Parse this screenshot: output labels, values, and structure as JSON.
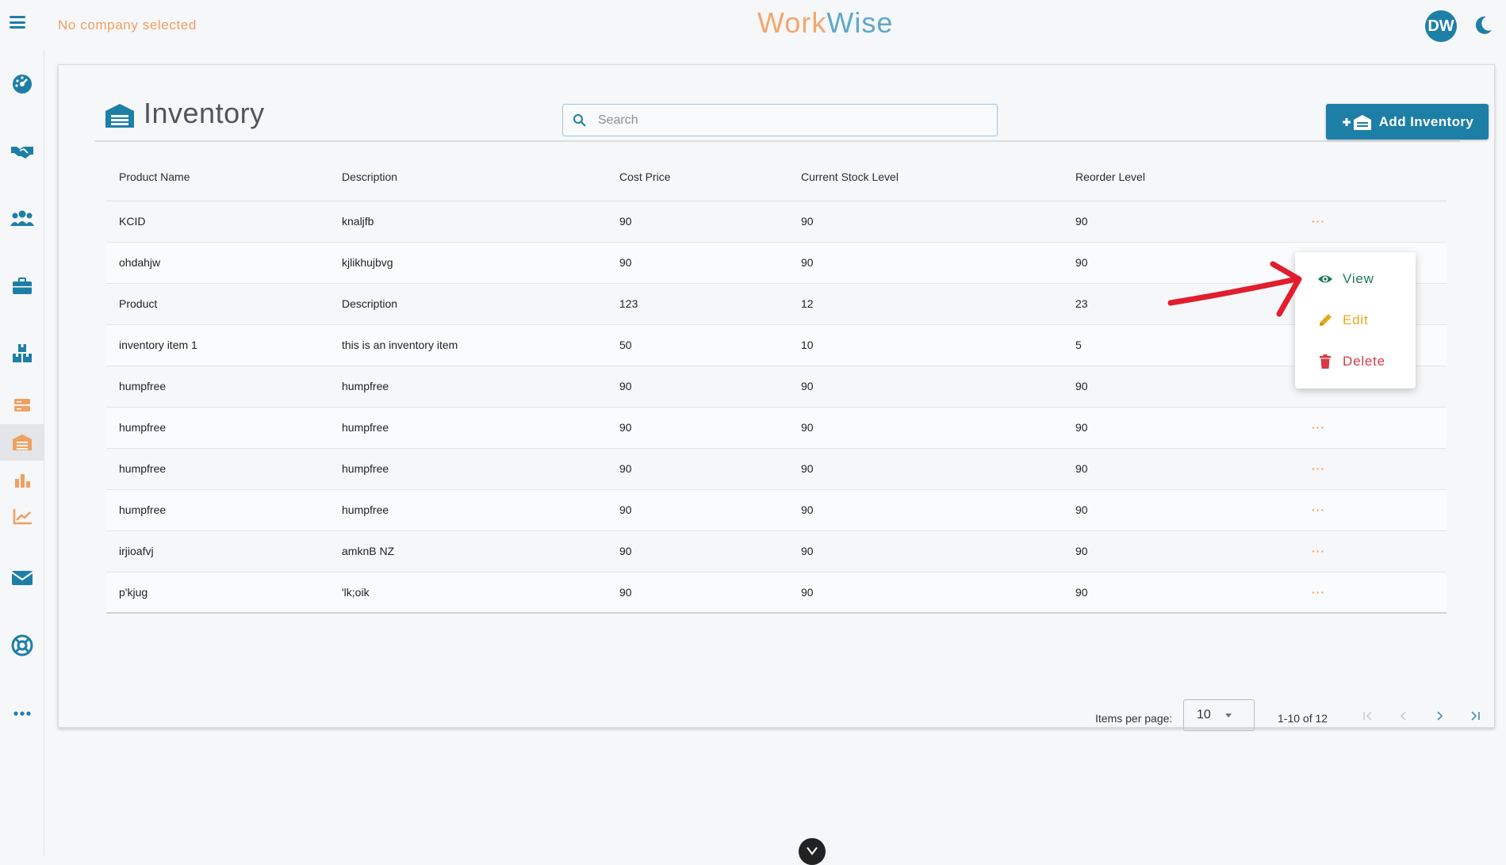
{
  "header": {
    "company_status": "No company selected",
    "brand_part1": "Work",
    "brand_part2": "Wise",
    "avatar_initials": "DW"
  },
  "sidebar": {
    "items": [
      {
        "icon": "dashboard-gauge-icon"
      },
      {
        "icon": "handshake-icon"
      },
      {
        "icon": "users-icon"
      },
      {
        "icon": "briefcase-icon"
      },
      {
        "icon": "boxes-icon"
      },
      {
        "icon": "server-icon"
      },
      {
        "icon": "warehouse-icon",
        "active": true
      },
      {
        "icon": "bar-chart-icon"
      },
      {
        "icon": "line-chart-icon"
      },
      {
        "icon": "envelope-icon"
      },
      {
        "icon": "lifebuoy-icon"
      },
      {
        "icon": "more-dots-icon"
      }
    ]
  },
  "page": {
    "title": "Inventory",
    "search_placeholder": "Search",
    "add_button_label": "Add Inventory"
  },
  "table": {
    "headers": [
      "Product Name",
      "Description",
      "Cost Price",
      "Current Stock Level",
      "Reorder Level"
    ],
    "rows": [
      [
        "KCID",
        "knaljfb",
        "90",
        "90",
        "90"
      ],
      [
        "ohdahjw",
        "kjlikhujbvg",
        "90",
        "90",
        "90"
      ],
      [
        "Product",
        "Description",
        "123",
        "12",
        "23"
      ],
      [
        "inventory item 1",
        "this is an inventory item",
        "50",
        "10",
        "5"
      ],
      [
        "humpfree",
        "humpfree",
        "90",
        "90",
        "90"
      ],
      [
        "humpfree",
        "humpfree",
        "90",
        "90",
        "90"
      ],
      [
        "humpfree",
        "humpfree",
        "90",
        "90",
        "90"
      ],
      [
        "humpfree",
        "humpfree",
        "90",
        "90",
        "90"
      ],
      [
        "irjioafvj",
        "amknB NZ",
        "90",
        "90",
        "90"
      ],
      [
        "p'kjug",
        "'lk;oik",
        "90",
        "90",
        "90"
      ]
    ],
    "row_action_label": "···"
  },
  "paginator": {
    "items_per_page_label": "Items per page:",
    "items_per_page_value": "10",
    "range_label": "1-10 of 12"
  },
  "row_menu": {
    "view_label": "View",
    "edit_label": "Edit",
    "delete_label": "Delete"
  },
  "colors": {
    "primary": "#1e7fa6",
    "accent_orange": "#f0a060",
    "view_green": "#1e7a5a",
    "edit_yellow": "#e8a81c",
    "delete_red": "#d63a45",
    "annotation_red": "#e11d2e"
  }
}
